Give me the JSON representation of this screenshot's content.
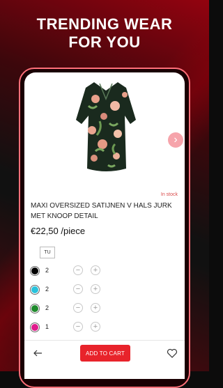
{
  "headline": {
    "line1": "TRENDING WEAR",
    "line2": "FOR YOU"
  },
  "product": {
    "stock": "In stock",
    "title": "MAXI OVERSIZED SATIJNEN V HALS JURK MET KNOOP DETAIL",
    "price": "€22,50 /piece",
    "size": "TU"
  },
  "colors": [
    {
      "hex": "#000000",
      "qty": "2"
    },
    {
      "hex": "#29c2dc",
      "qty": "2"
    },
    {
      "hex": "#1f8a2c",
      "qty": "2"
    },
    {
      "hex": "#e01b8c",
      "qty": "1"
    }
  ],
  "stepper": {
    "minus": "−",
    "plus": "+"
  },
  "bottom": {
    "add_to_cart": "ADD TO CART"
  },
  "icons": {
    "back": "arrow-left-icon",
    "next": "chevron-right-icon",
    "wishlist": "heart-icon"
  }
}
